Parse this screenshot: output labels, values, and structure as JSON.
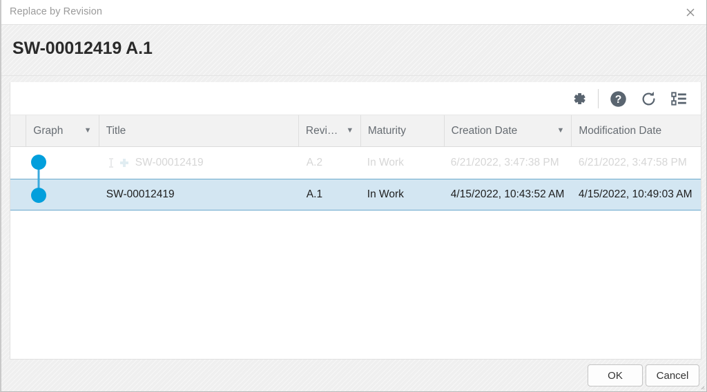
{
  "window": {
    "title": "Replace by Revision",
    "close_icon": "close-icon",
    "heading": "SW-00012419 A.1"
  },
  "toolbar": {
    "icons": [
      {
        "name": "settings-gear-icon",
        "label": "Settings"
      },
      {
        "name": "help-icon",
        "label": "Help"
      },
      {
        "name": "refresh-icon",
        "label": "Refresh"
      },
      {
        "name": "tree-view-icon",
        "label": "Tree View"
      }
    ]
  },
  "table": {
    "columns": [
      {
        "key": "graph",
        "label": "Graph",
        "sortable": true
      },
      {
        "key": "title",
        "label": "Title",
        "sortable": false
      },
      {
        "key": "revision",
        "label": "Revi…",
        "sortable": true
      },
      {
        "key": "maturity",
        "label": "Maturity",
        "sortable": false
      },
      {
        "key": "creation_date",
        "label": "Creation Date",
        "sortable": true
      },
      {
        "key": "modification_date",
        "label": "Modification Date",
        "sortable": false
      }
    ],
    "sort_caret": "▼",
    "rows": [
      {
        "title": "SW-00012419",
        "revision": "A.2",
        "maturity": "In Work",
        "creation_date": "6/21/2022, 3:47:38 PM",
        "modification_date": "6/21/2022, 3:47:58 PM",
        "selected": false,
        "dimmed": true,
        "icons": [
          "lock-icon",
          "add-badge-icon"
        ]
      },
      {
        "title": "SW-00012419",
        "revision": "A.1",
        "maturity": "In Work",
        "creation_date": "4/15/2022, 10:43:52 AM",
        "modification_date": "4/15/2022, 10:49:03 AM",
        "selected": true,
        "dimmed": false,
        "icons": []
      }
    ]
  },
  "footer": {
    "ok_label": "OK",
    "cancel_label": "Cancel"
  },
  "colors": {
    "graph_node": "#029fdc",
    "selection_bg": "#d3e6f2",
    "selection_border": "#6aa8cc",
    "icon_gray": "#5a6570",
    "heading_text": "#2a2a2a"
  }
}
